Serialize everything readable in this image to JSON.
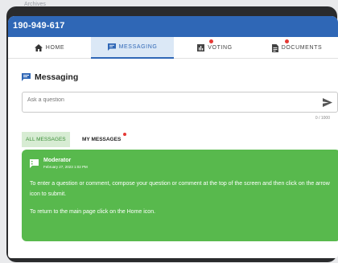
{
  "background": {
    "text": "Archives"
  },
  "header": {
    "meeting_id": "190-949-617"
  },
  "tabs": [
    {
      "label": "HOME",
      "icon": "home-icon",
      "active": false,
      "badge": false
    },
    {
      "label": "MESSAGING",
      "icon": "messaging-icon",
      "active": true,
      "badge": false
    },
    {
      "label": "VOTING",
      "icon": "voting-icon",
      "active": false,
      "badge": true
    },
    {
      "label": "DOCUMENTS",
      "icon": "documents-icon",
      "active": false,
      "badge": true
    }
  ],
  "messaging": {
    "title": "Messaging",
    "input_placeholder": "Ask a question",
    "counter": "0 / 1000",
    "subtabs": {
      "all": "ALL MESSAGES",
      "mine": "MY MESSAGES"
    },
    "message": {
      "author": "Moderator",
      "date": "February 27, 2023 1:02 PM",
      "paragraph1": "To enter a question or comment, compose your question or comment at the top of the screen and then click on the arrow icon to submit.",
      "paragraph2": "To return to the main page click on the Home icon."
    }
  },
  "colors": {
    "accent": "#2f67b6",
    "message_bg": "#58b94d",
    "badge": "#e53935"
  }
}
